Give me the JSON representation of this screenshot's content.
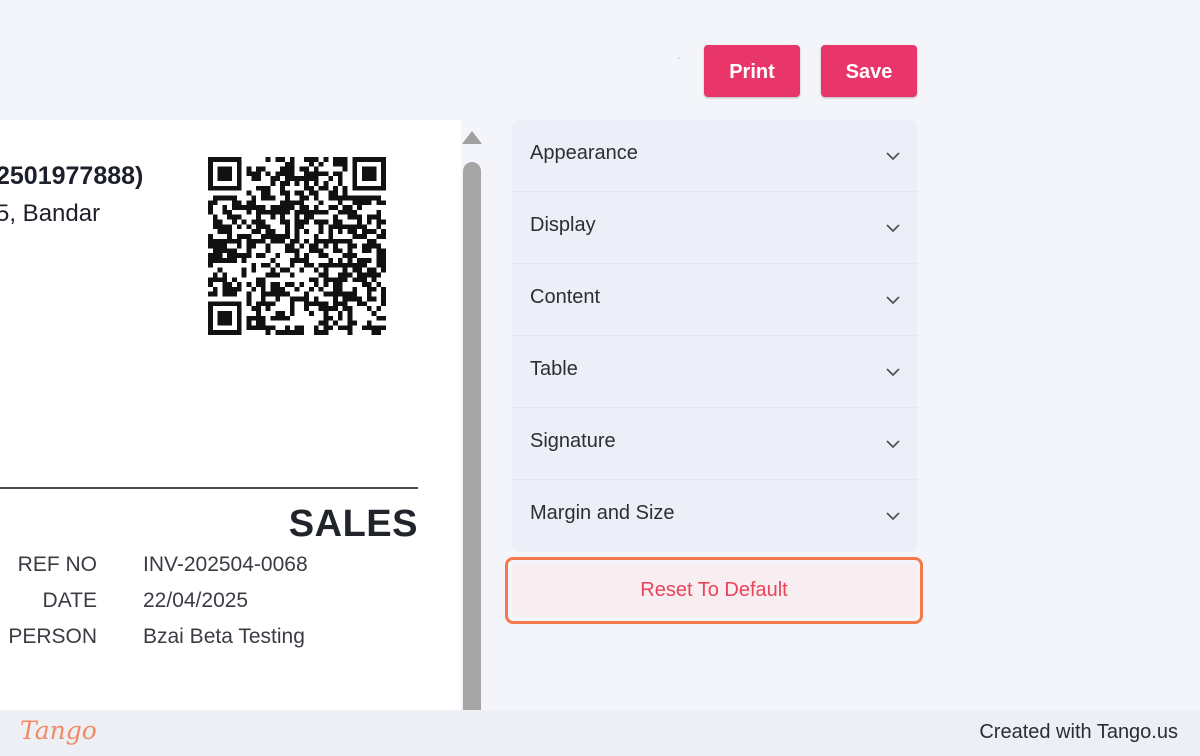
{
  "toolbar": {
    "print_label": "Print",
    "save_label": "Save"
  },
  "preview": {
    "company_id_fragment": "2501977888)",
    "address_fragment": "5, Bandar",
    "document_title": "SALES",
    "info": [
      {
        "label": "REF NO",
        "value": "INV-202504-0068"
      },
      {
        "label": "DATE",
        "value": "22/04/2025"
      },
      {
        "label": "PERSON",
        "value": "Bzai Beta Testing"
      }
    ]
  },
  "settings": {
    "sections": [
      "Appearance",
      "Display",
      "Content",
      "Table",
      "Signature",
      "Margin and Size"
    ],
    "reset_label": "Reset To Default"
  },
  "footer": {
    "logo_text": "Tango",
    "credit": "Created with Tango.us"
  },
  "colors": {
    "accent": "#e8366a",
    "highlight": "#f47a4b",
    "reset_text": "#e8445a",
    "panel": "#eceff8"
  },
  "icons": {
    "accordion": "chevron-down-icon",
    "scroll": "scroll-up-arrow-icon"
  }
}
